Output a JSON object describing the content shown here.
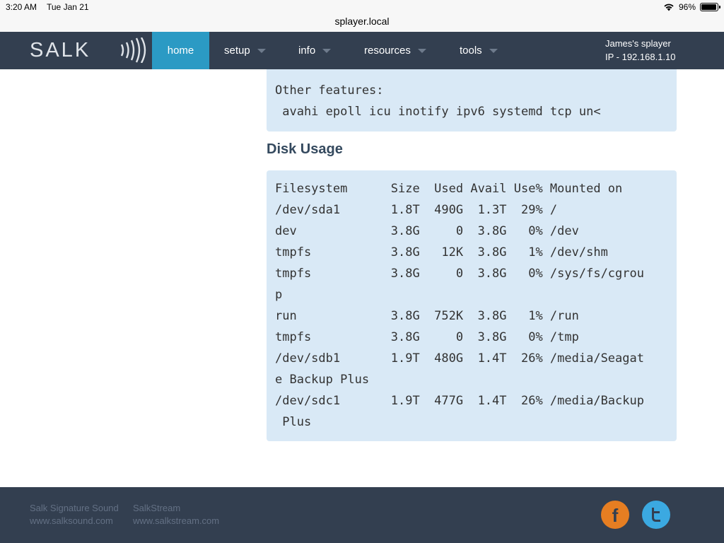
{
  "status_bar": {
    "time": "3:20 AM",
    "date": "Tue Jan 21",
    "battery": "96%",
    "battery_level": 0.96
  },
  "address_bar": {
    "url": "splayer.local"
  },
  "nav": {
    "logo_text": "SALK",
    "items": [
      {
        "label": "home",
        "active": true
      },
      {
        "label": "setup",
        "active": false
      },
      {
        "label": "info",
        "active": false
      },
      {
        "label": "resources",
        "active": false
      },
      {
        "label": "tools",
        "active": false
      }
    ],
    "device_name": "James's splayer",
    "device_ip": "IP - 192.168.1.10"
  },
  "other_features": {
    "lines": [
      "Other features:",
      " avahi epoll icu inotify ipv6 systemd tcp un<"
    ]
  },
  "disk_usage": {
    "title": "Disk Usage",
    "lines": [
      "Filesystem      Size  Used Avail Use% Mounted on",
      "/dev/sda1       1.8T  490G  1.3T  29% /",
      "dev             3.8G     0  3.8G   0% /dev",
      "tmpfs           3.8G   12K  3.8G   1% /dev/shm",
      "tmpfs           3.8G     0  3.8G   0% /sys/fs/cgrou",
      "p",
      "run             3.8G  752K  3.8G   1% /run",
      "tmpfs           3.8G     0  3.8G   0% /tmp",
      "/dev/sdb1       1.9T  480G  1.4T  26% /media/Seagat",
      "e Backup Plus",
      "/dev/sdc1       1.9T  477G  1.4T  26% /media/Backup",
      " Plus"
    ]
  },
  "footer": {
    "col1": {
      "title": "Salk Signature Sound",
      "link": "www.salksound.com"
    },
    "col2": {
      "title": "SalkStream",
      "link": "www.salkstream.com"
    },
    "facebook_glyph": "f",
    "colors": {
      "facebook": "#e67e22",
      "twitter": "#3ba9e1"
    }
  },
  "colors": {
    "nav_bg": "#333f50",
    "active_tab": "#2b9ac4",
    "code_bg": "#d9e9f6"
  }
}
